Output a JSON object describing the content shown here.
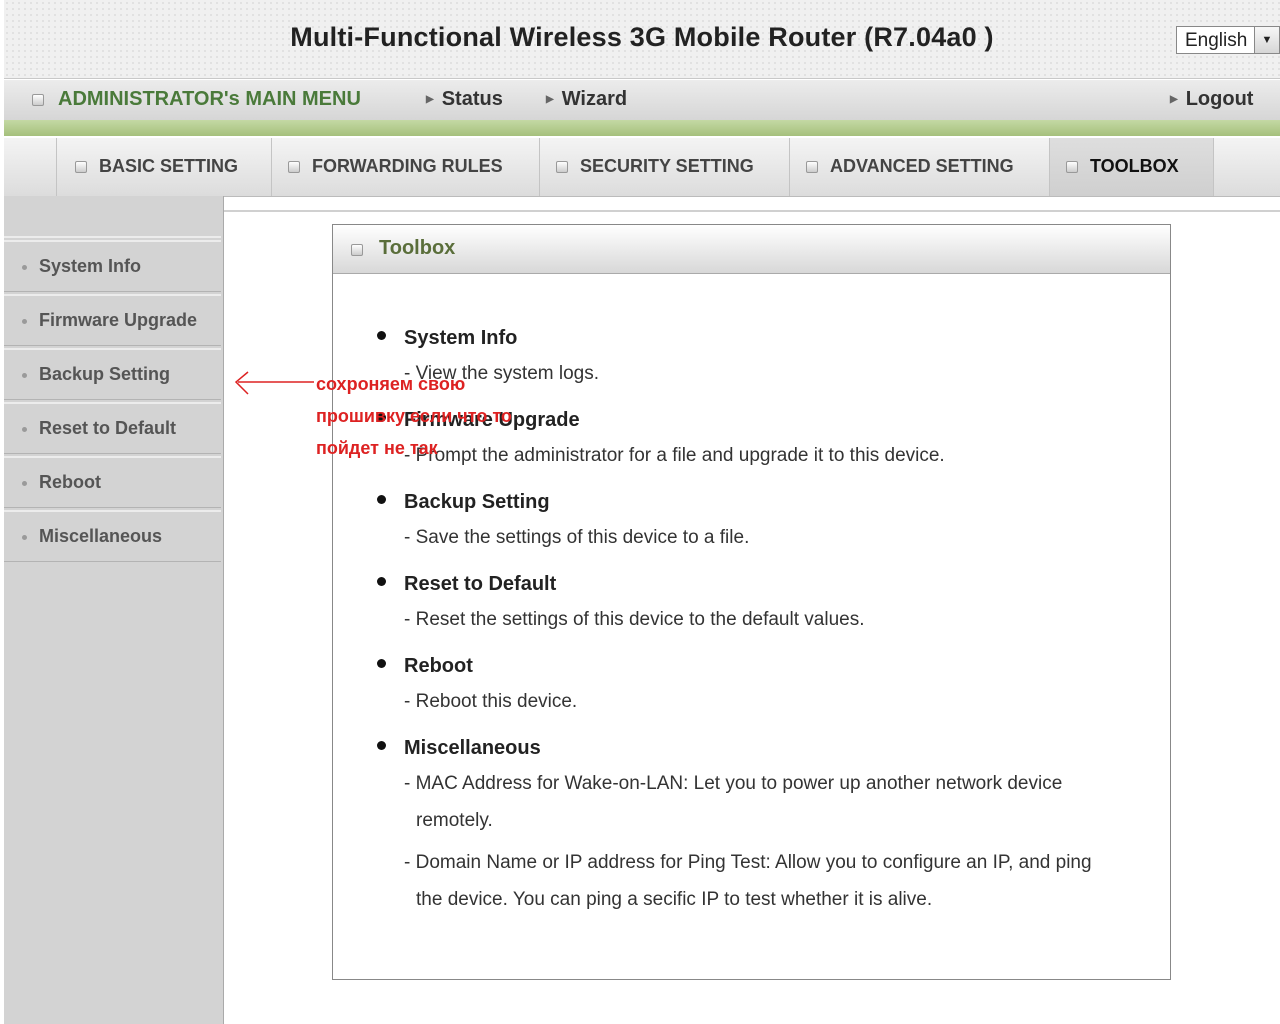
{
  "header": {
    "title": "Multi-Functional Wireless 3G Mobile Router (R7.04a0 )",
    "language": "English"
  },
  "mainmenu": {
    "admin": "ADMINISTRATOR's MAIN MENU",
    "status": "Status",
    "wizard": "Wizard",
    "logout": "Logout"
  },
  "tabs": [
    {
      "label": "BASIC SETTING"
    },
    {
      "label": "FORWARDING RULES"
    },
    {
      "label": "SECURITY SETTING"
    },
    {
      "label": "ADVANCED SETTING"
    },
    {
      "label": "TOOLBOX",
      "active": true
    }
  ],
  "sidebar": {
    "items": [
      {
        "label": "System Info"
      },
      {
        "label": "Firmware Upgrade"
      },
      {
        "label": "Backup Setting"
      },
      {
        "label": "Reset to Default"
      },
      {
        "label": "Reboot"
      },
      {
        "label": "Miscellaneous"
      }
    ]
  },
  "panel": {
    "title": "Toolbox",
    "entries": [
      {
        "name": "System Info",
        "desc": [
          "- View the system logs."
        ]
      },
      {
        "name": "Firmware Upgrade",
        "desc": [
          "- Prompt the administrator for a file and upgrade it to this device."
        ]
      },
      {
        "name": "Backup Setting",
        "desc": [
          "- Save the settings of this device to a file."
        ]
      },
      {
        "name": "Reset to Default",
        "desc": [
          "- Reset the settings of this device to the default values."
        ]
      },
      {
        "name": "Reboot",
        "desc": [
          "- Reboot this device."
        ]
      },
      {
        "name": "Miscellaneous",
        "desc": [
          "- MAC Address for Wake-on-LAN: Let you to power up another network device",
          "remotely.",
          "- Domain Name or IP address for Ping Test: Allow you to configure an IP, and ping",
          "the device. You can ping a secific IP to test whether it is alive."
        ]
      }
    ]
  },
  "annotation": {
    "lines": [
      "сохроняем свою",
      "прошивку если что то",
      "пойдет не так"
    ],
    "color": "#dd2222"
  }
}
